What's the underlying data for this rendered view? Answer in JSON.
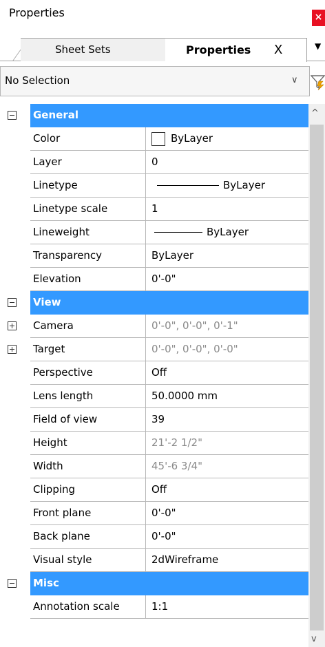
{
  "window": {
    "title": "Properties",
    "close_label": "×"
  },
  "tabs": {
    "sheet_sets": "Sheet Sets",
    "properties": "Properties",
    "close": "X",
    "menu_arrow": "▼"
  },
  "selection": {
    "value": "No Selection",
    "chevron": "∨",
    "filter_icon": "quick-select-filter-icon"
  },
  "categories": {
    "general": "General",
    "view": "View",
    "misc": "Misc"
  },
  "rows": {
    "color": {
      "name": "Color",
      "value": "ByLayer"
    },
    "layer": {
      "name": "Layer",
      "value": "0"
    },
    "linetype": {
      "name": "Linetype",
      "value": "ByLayer"
    },
    "linetype_scale": {
      "name": "Linetype scale",
      "value": "1"
    },
    "lineweight": {
      "name": "Lineweight",
      "value": "ByLayer"
    },
    "transparency": {
      "name": "Transparency",
      "value": "ByLayer"
    },
    "elevation": {
      "name": "Elevation",
      "value": "0'-0\""
    },
    "camera": {
      "name": "Camera",
      "value": "0'-0\", 0'-0\", 0'-1\""
    },
    "target": {
      "name": "Target",
      "value": "0'-0\", 0'-0\", 0'-0\""
    },
    "perspective": {
      "name": "Perspective",
      "value": "Off"
    },
    "lens_length": {
      "name": "Lens length",
      "value": "50.0000 mm"
    },
    "field_of_view": {
      "name": "Field of view",
      "value": "39"
    },
    "height": {
      "name": "Height",
      "value": "21'-2 1/2\""
    },
    "width": {
      "name": "Width",
      "value": "45'-6 3/4\""
    },
    "clipping": {
      "name": "Clipping",
      "value": "Off"
    },
    "front_plane": {
      "name": "Front plane",
      "value": "0'-0\""
    },
    "back_plane": {
      "name": "Back plane",
      "value": "0'-0\""
    },
    "visual_style": {
      "name": "Visual style",
      "value": "2dWireframe"
    },
    "annotation_scale": {
      "name": "Annotation scale",
      "value": "1:1"
    }
  },
  "scrollbar": {
    "up": "^",
    "down": "v"
  },
  "colors": {
    "category_band": "#3399ff",
    "close_button": "#e81123",
    "disabled_text": "#8a8a8a"
  }
}
